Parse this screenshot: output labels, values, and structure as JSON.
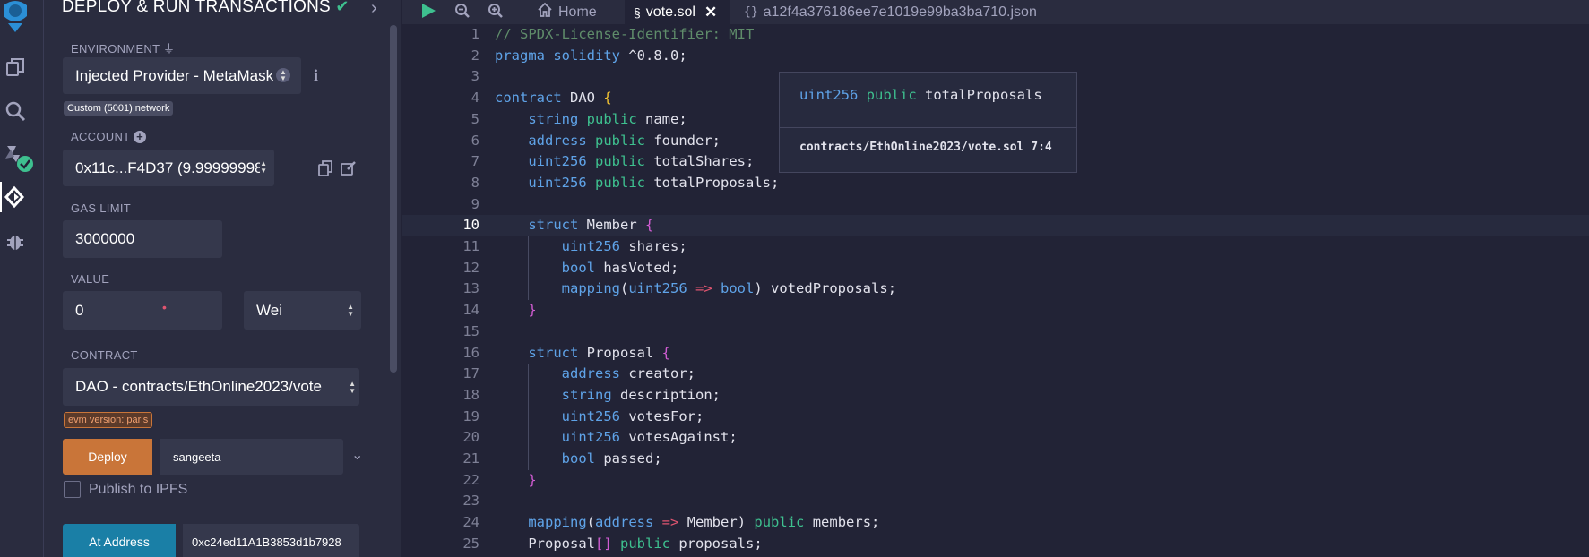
{
  "panel": {
    "title": "DEPLOY & RUN TRANSACTIONS",
    "environment": {
      "label": "ENVIRONMENT",
      "value": "Injected Provider - MetaMask",
      "network_badge": "Custom (5001) network"
    },
    "account": {
      "label": "ACCOUNT",
      "value": "0x11c...F4D37 (9.99999998"
    },
    "gas_limit": {
      "label": "GAS LIMIT",
      "value": "3000000"
    },
    "value": {
      "label": "VALUE",
      "amount": "0",
      "unit": "Wei"
    },
    "contract": {
      "label": "CONTRACT",
      "value": "DAO - contracts/EthOnline2023/vote",
      "evm_badge": "evm version: paris"
    },
    "deploy": {
      "button": "Deploy",
      "arg": "sangeeta"
    },
    "publish": {
      "label": "Publish to IPFS",
      "checked": false
    },
    "at_address": {
      "button": "At Address",
      "value": "0xc24ed11A1B3853d1b7928"
    }
  },
  "tabs": [
    {
      "label": "Home",
      "icon": "home-icon",
      "active": false
    },
    {
      "label": "vote.sol",
      "icon": "solidity-icon",
      "active": true
    },
    {
      "label": "a12f4a376186ee7e1019e99ba3ba710.json",
      "icon": "json-braces-icon",
      "active": false
    }
  ],
  "editor": {
    "current_line": 10,
    "lines": [
      {
        "n": "1",
        "code": "// SPDX-License-Identifier: MIT"
      },
      {
        "n": "2",
        "code": "pragma solidity ^0.8.0;"
      },
      {
        "n": "3",
        "code": ""
      },
      {
        "n": "4",
        "code": "contract DAO {"
      },
      {
        "n": "5",
        "code": "    string public name;"
      },
      {
        "n": "6",
        "code": "    address public founder;"
      },
      {
        "n": "7",
        "code": "    uint256 public totalShares;"
      },
      {
        "n": "8",
        "code": "    uint256 public totalProposals;"
      },
      {
        "n": "9",
        "code": ""
      },
      {
        "n": "10",
        "code": "    struct Member {"
      },
      {
        "n": "11",
        "code": "        uint256 shares;"
      },
      {
        "n": "12",
        "code": "        bool hasVoted;"
      },
      {
        "n": "13",
        "code": "        mapping(uint256 => bool) votedProposals;"
      },
      {
        "n": "14",
        "code": "    }"
      },
      {
        "n": "15",
        "code": ""
      },
      {
        "n": "16",
        "code": "    struct Proposal {"
      },
      {
        "n": "17",
        "code": "        address creator;"
      },
      {
        "n": "18",
        "code": "        string description;"
      },
      {
        "n": "19",
        "code": "        uint256 votesFor;"
      },
      {
        "n": "20",
        "code": "        uint256 votesAgainst;"
      },
      {
        "n": "21",
        "code": "        bool passed;"
      },
      {
        "n": "22",
        "code": "    }"
      },
      {
        "n": "23",
        "code": ""
      },
      {
        "n": "24",
        "code": "    mapping(address => Member) public members;"
      },
      {
        "n": "25",
        "code": "    Proposal[] public proposals;"
      }
    ],
    "hover": {
      "signature": "uint256 public totalProposals",
      "source": "contracts/EthOnline2023/vote.sol 7:4"
    }
  },
  "colors": {
    "deploy_button": "#c97539",
    "at_address_button": "#1a7fa6",
    "rail_accent": "#3ec08f",
    "logo_blue": "#2b8fd6"
  }
}
